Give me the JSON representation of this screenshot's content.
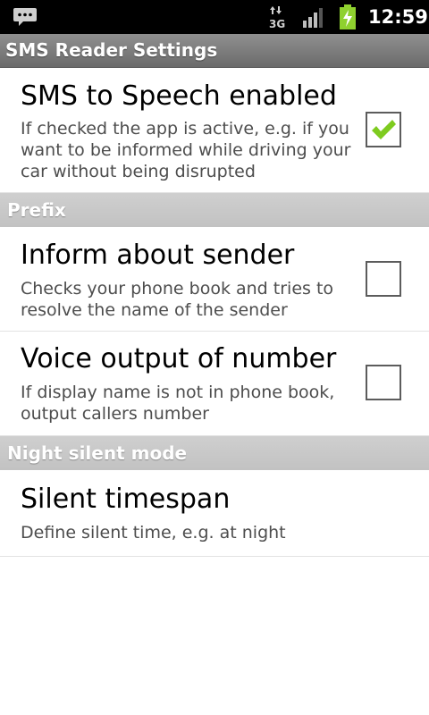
{
  "status_bar": {
    "time": "12:59",
    "network_label": "3G"
  },
  "title_bar": {
    "title": "SMS Reader Settings"
  },
  "preferences": {
    "sms_to_speech": {
      "title": "SMS to Speech enabled",
      "summary": "If checked the app is active, e.g. if you want to be informed while driving your car without being disrupted",
      "checked": true
    },
    "prefix_category": "Prefix",
    "inform_sender": {
      "title": "Inform about sender",
      "summary": "Checks your phone book and tries to resolve the name of the sender",
      "checked": false
    },
    "voice_number": {
      "title": "Voice output of number",
      "summary": "If display name is not in phone book, output callers number",
      "checked": false
    },
    "night_category": "Night silent mode",
    "silent_timespan": {
      "title": "Silent timespan",
      "summary": "Define silent time, e.g. at night"
    }
  },
  "icons": {
    "notification": "message-bubble-icon",
    "data": "data-3g-icon",
    "signal": "signal-strength-icon",
    "battery": "battery-charging-icon",
    "check": "checkmark-icon"
  },
  "colors": {
    "check_green": "#7ecb1f",
    "battery_green": "#8fd12f",
    "category_bg": "#c8c8c8",
    "title_bar_bg": "#7d7d7d"
  }
}
